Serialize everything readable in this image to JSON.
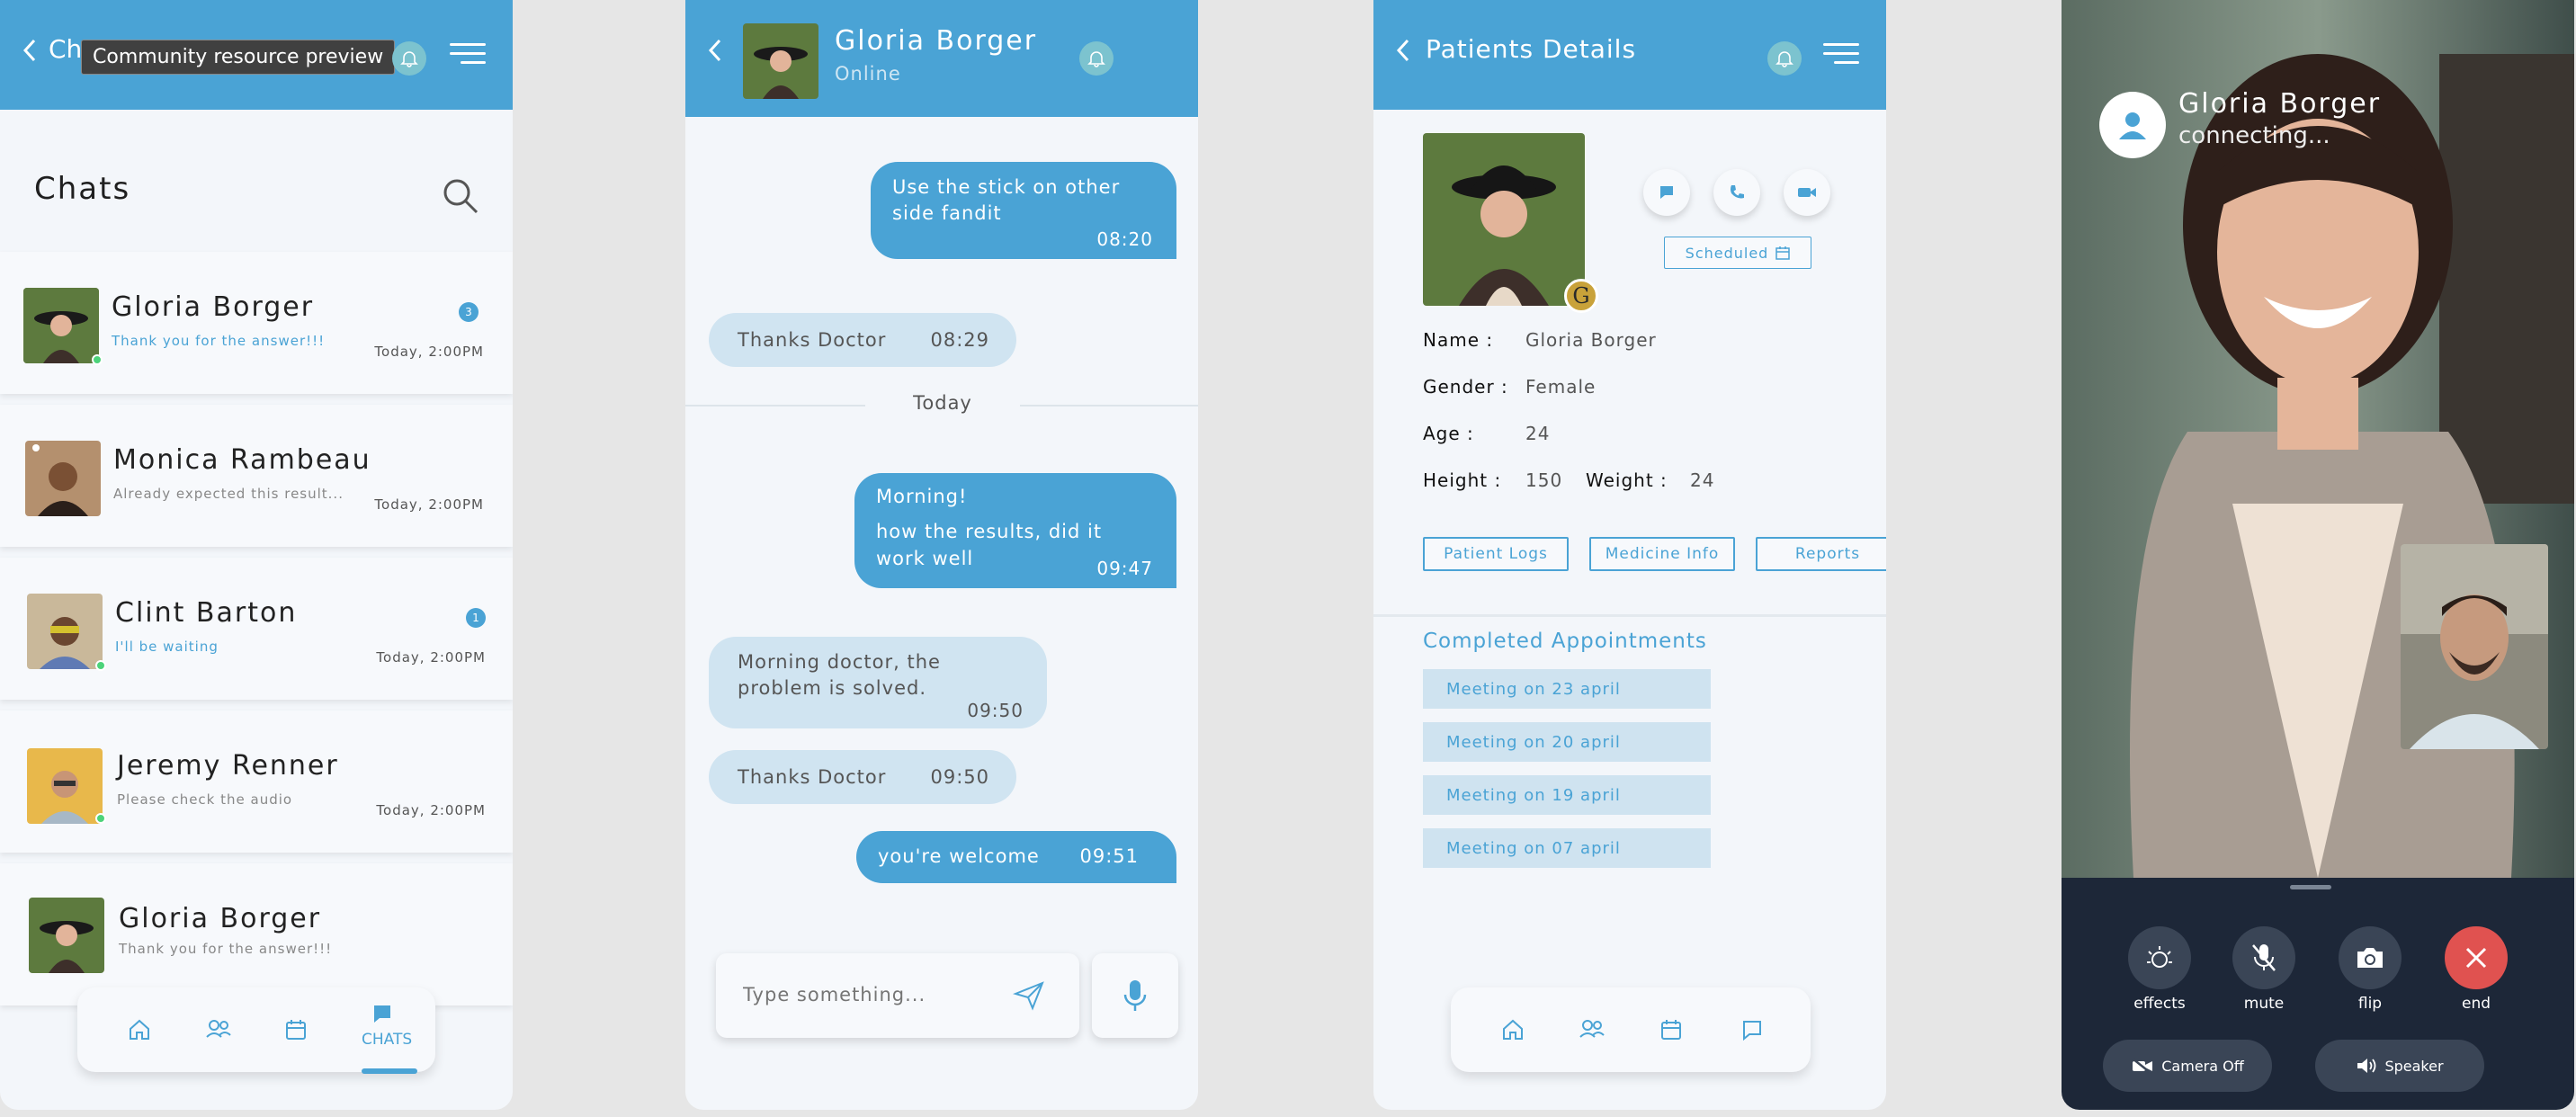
{
  "chats_screen": {
    "back_title": "Ch",
    "tooltip": "Community resource preview",
    "title": "Chats",
    "items": [
      {
        "name": "Gloria Borger",
        "message": "Thank you for the answer!!!",
        "time": "Today, 2:00PM",
        "badge": "3",
        "highlight": true
      },
      {
        "name": "Monica Rambeau",
        "message": "Already expected this result...",
        "time": "Today, 2:00PM",
        "badge": null,
        "highlight": false
      },
      {
        "name": "Clint Barton",
        "message": "I'll be waiting",
        "time": "Today, 2:00PM",
        "badge": "1",
        "highlight": true
      },
      {
        "name": "Jeremy Renner",
        "message": "Please check the audio",
        "time": "Today, 2:00PM",
        "badge": null,
        "highlight": false
      },
      {
        "name": "Gloria Borger",
        "message": "Thank you for the answer!!!",
        "time": "",
        "badge": null,
        "highlight": false
      }
    ],
    "nav_active_label": "CHATS"
  },
  "conversation": {
    "contact_name": "Gloria Borger",
    "status": "Online",
    "date_separator": "Today",
    "messages": [
      {
        "dir": "out",
        "text": "Use the stick on  other side fandit",
        "time": "08:20"
      },
      {
        "dir": "in",
        "text": "Thanks Doctor",
        "time": "08:29"
      },
      {
        "dir": "out",
        "text": "Morning!",
        "text2": "how the results, did it work well",
        "time": "09:47"
      },
      {
        "dir": "in",
        "text": "Morning doctor, the problem is solved.",
        "time": "09:50"
      },
      {
        "dir": "in",
        "text": "Thanks Doctor",
        "time": "09:50"
      },
      {
        "dir": "out",
        "text": "you're welcome",
        "time": "09:51"
      }
    ],
    "input_placeholder": "Type something..."
  },
  "patient": {
    "title": "Patients Details",
    "avatar_initial": "G",
    "scheduled_label": "Scheduled",
    "fields": {
      "name_label": "Name :",
      "name": "Gloria Borger",
      "gender_label": "Gender :",
      "gender": "Female",
      "age_label": "Age :",
      "age": "24",
      "height_label": "Height :",
      "height": "150",
      "weight_label": "Weight :",
      "weight": "24"
    },
    "tabs": [
      "Patient Logs",
      "Medicine Info",
      "Reports"
    ],
    "section_title": "Completed Appointments",
    "appointments": [
      "Meeting on 23 april",
      "Meeting on 20 april",
      "Meeting on 19 april",
      "Meeting on 07 april"
    ]
  },
  "call": {
    "name": "Gloria Borger",
    "status": "connecting...",
    "controls": [
      "effects",
      "mute",
      "flip",
      "end"
    ],
    "camera_off": "Camera Off",
    "speaker": "Speaker"
  },
  "colors": {
    "accent": "#4aa3d5",
    "end_call": "#e05250",
    "call_panel": "#1d2738"
  }
}
